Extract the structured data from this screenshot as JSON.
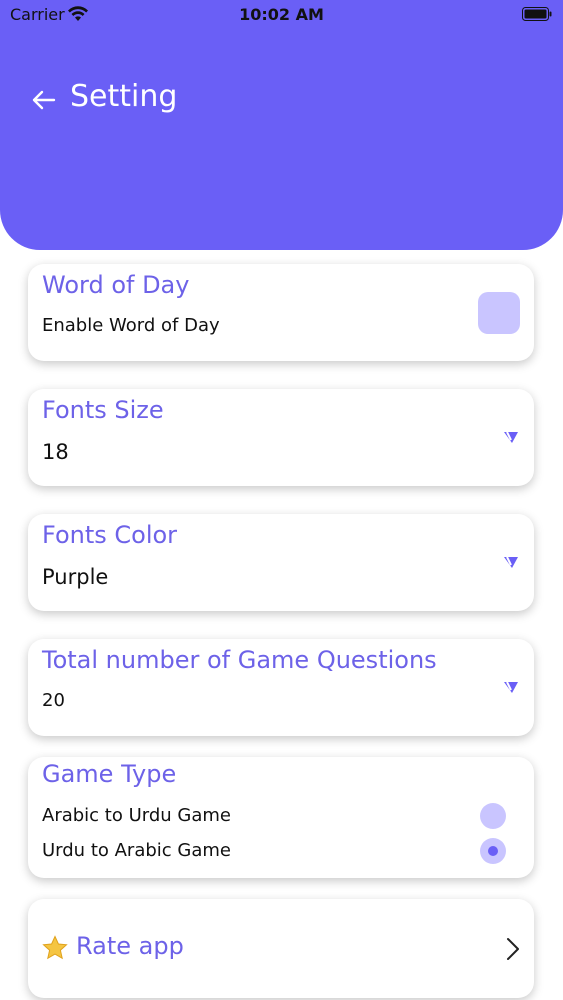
{
  "status_bar": {
    "carrier": "Carrier",
    "time": "10:02 AM"
  },
  "header": {
    "title": "Setting"
  },
  "cards": {
    "word_of_day": {
      "title": "Word of Day",
      "label": "Enable Word of Day"
    },
    "fonts_size": {
      "title": "Fonts Size",
      "value": "18"
    },
    "fonts_color": {
      "title": "Fonts Color",
      "value": "Purple"
    },
    "game_questions": {
      "title": "Total number of Game Questions",
      "value": "20"
    },
    "game_type": {
      "title": "Game Type",
      "options": [
        "Arabic to Urdu Game",
        "Urdu to Arabic Game"
      ],
      "selected_index": 1
    },
    "rate": {
      "label": "Rate app"
    }
  },
  "colors": {
    "accent": "#6a5ff6",
    "accent_light": "#c9c5ff",
    "card_title": "#6d62e8"
  },
  "icons": [
    "wifi-icon",
    "battery-icon",
    "back-arrow-icon",
    "dropdown-icon",
    "star-icon",
    "chevron-right-icon"
  ]
}
